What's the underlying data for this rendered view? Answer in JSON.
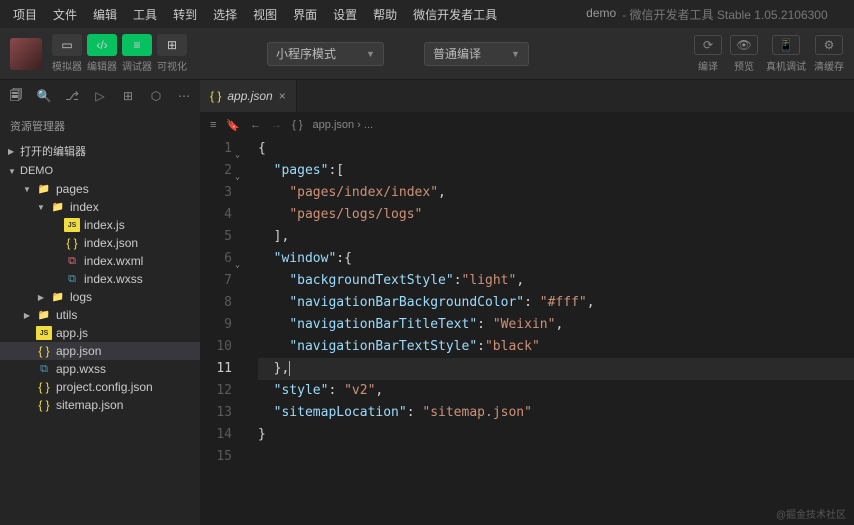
{
  "menu": [
    "项目",
    "文件",
    "编辑",
    "工具",
    "转到",
    "选择",
    "视图",
    "界面",
    "设置",
    "帮助",
    "微信开发者工具"
  ],
  "title": {
    "app": "demo",
    "suffix": "- 微信开发者工具 Stable 1.05.2106300"
  },
  "toolbar": {
    "panel_labels": [
      "模拟器",
      "编辑器",
      "调试器",
      "可视化"
    ],
    "mode_dropdown": "小程序模式",
    "compile_dropdown": "普通编译",
    "right": [
      "编译",
      "预览",
      "真机调试",
      "清缓存"
    ]
  },
  "sidebar": {
    "title": "资源管理器",
    "sections": {
      "open_editors": "打开的编辑器",
      "project": "DEMO"
    },
    "tree": [
      {
        "type": "folder",
        "name": "pages",
        "open": true,
        "icon": "folder",
        "depth": 1
      },
      {
        "type": "folder",
        "name": "index",
        "open": true,
        "icon": "folder-g",
        "depth": 2
      },
      {
        "type": "file",
        "name": "index.js",
        "icon": "js",
        "depth": 3
      },
      {
        "type": "file",
        "name": "index.json",
        "icon": "json",
        "depth": 3
      },
      {
        "type": "file",
        "name": "index.wxml",
        "icon": "wxml",
        "depth": 3
      },
      {
        "type": "file",
        "name": "index.wxss",
        "icon": "wxss",
        "depth": 3
      },
      {
        "type": "folder",
        "name": "logs",
        "open": false,
        "icon": "folder-g",
        "depth": 2
      },
      {
        "type": "folder",
        "name": "utils",
        "open": false,
        "icon": "folder-g",
        "depth": 1
      },
      {
        "type": "file",
        "name": "app.js",
        "icon": "js",
        "depth": 1
      },
      {
        "type": "file",
        "name": "app.json",
        "icon": "json",
        "depth": 1,
        "selected": true
      },
      {
        "type": "file",
        "name": "app.wxss",
        "icon": "wxss",
        "depth": 1
      },
      {
        "type": "file",
        "name": "project.config.json",
        "icon": "json",
        "depth": 1
      },
      {
        "type": "file",
        "name": "sitemap.json",
        "icon": "json",
        "depth": 1
      }
    ]
  },
  "editor": {
    "tab_name": "app.json",
    "breadcrumb": "app.json › ...",
    "current_line": 11,
    "lines": [
      {
        "n": 1,
        "fold": true,
        "html": "<span class='s-pun'>{</span>"
      },
      {
        "n": 2,
        "fold": true,
        "html": "  <span class='s-key'>\"pages\"</span><span class='s-pun'>:[</span>"
      },
      {
        "n": 3,
        "html": "    <span class='s-str'>\"pages/index/index\"</span><span class='s-pun'>,</span>"
      },
      {
        "n": 4,
        "html": "    <span class='s-str'>\"pages/logs/logs\"</span>"
      },
      {
        "n": 5,
        "html": "  <span class='s-pun'>],</span>"
      },
      {
        "n": 6,
        "fold": true,
        "html": "  <span class='s-key'>\"window\"</span><span class='s-pun'>:{</span>"
      },
      {
        "n": 7,
        "html": "    <span class='s-key'>\"backgroundTextStyle\"</span><span class='s-pun'>:</span><span class='s-str'>\"light\"</span><span class='s-pun'>,</span>"
      },
      {
        "n": 8,
        "html": "    <span class='s-key'>\"navigationBarBackgroundColor\"</span><span class='s-pun'>: </span><span class='s-str'>\"#fff\"</span><span class='s-pun'>,</span>"
      },
      {
        "n": 9,
        "html": "    <span class='s-key'>\"navigationBarTitleText\"</span><span class='s-pun'>: </span><span class='s-str'>\"Weixin\"</span><span class='s-pun'>,</span>"
      },
      {
        "n": 10,
        "html": "    <span class='s-key'>\"navigationBarTextStyle\"</span><span class='s-pun'>:</span><span class='s-str'>\"black\"</span>"
      },
      {
        "n": 11,
        "cur": true,
        "html": "  <span class='s-pun'>},</span><span class='cursor'></span>"
      },
      {
        "n": 12,
        "html": "  <span class='s-key'>\"style\"</span><span class='s-pun'>: </span><span class='s-str'>\"v2\"</span><span class='s-pun'>,</span>"
      },
      {
        "n": 13,
        "html": "  <span class='s-key'>\"sitemapLocation\"</span><span class='s-pun'>: </span><span class='s-str'>\"sitemap.json\"</span>"
      },
      {
        "n": 14,
        "html": "<span class='s-pun'>}</span>"
      },
      {
        "n": 15,
        "html": ""
      }
    ]
  },
  "watermark": "@掘金技术社区"
}
